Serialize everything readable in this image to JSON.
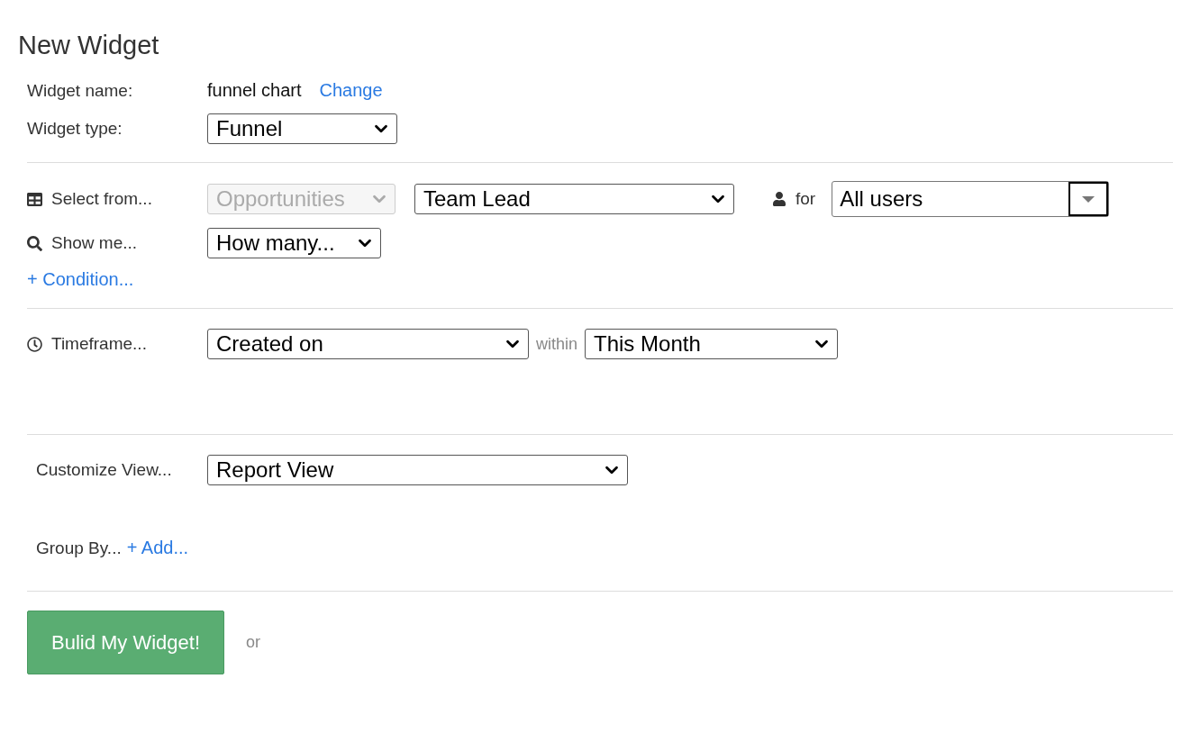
{
  "title": "New Widget",
  "widget_name": {
    "label": "Widget name:",
    "value": "funnel chart",
    "link": "Change"
  },
  "widget_type": {
    "label": "Widget type:",
    "value": "Funnel"
  },
  "select_from": {
    "label": "Select from...",
    "source": {
      "value": "Opportunities",
      "disabled": true
    },
    "role": "Team Lead",
    "for_label": "for",
    "users": "All users"
  },
  "show_me": {
    "label": "Show me...",
    "value": "How many..."
  },
  "condition_link": "+ Condition...",
  "timeframe": {
    "label": "Timeframe...",
    "field": "Created on",
    "within": "within",
    "period": "This Month"
  },
  "customize": {
    "label": "Customize View...",
    "value": "Report View"
  },
  "group_by": {
    "label": "Group By...",
    "link": "+ Add..."
  },
  "submit": "Bulid My Widget!",
  "or": "or"
}
